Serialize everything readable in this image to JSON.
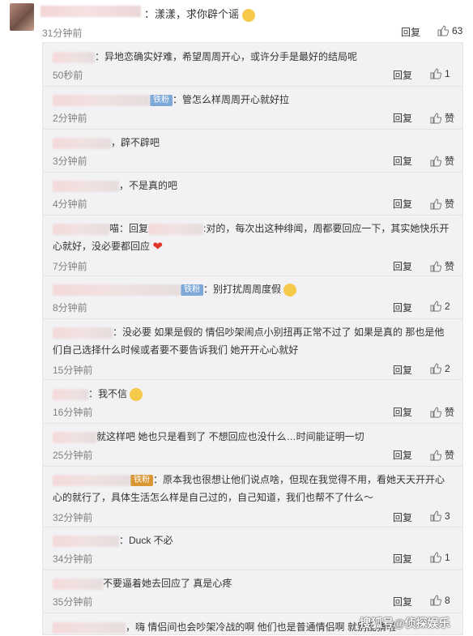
{
  "top_comment": {
    "text": "：漾漾，求你辟个谣",
    "time": "31分钟前",
    "reply": "回复",
    "likes": "63"
  },
  "replies": [
    {
      "text": "：异地恋确实好难，希望周周开心，或许分手是最好的结局呢",
      "time": "50秒前",
      "reply": "回复",
      "likes": "1"
    },
    {
      "badge": "铁粉",
      "text": "：管怎么样周周开心就好拉",
      "time": "2分钟前",
      "reply": "回复",
      "likes": "赞"
    },
    {
      "text": "，辟不辟吧",
      "time": "3分钟前",
      "reply": "回复",
      "likes": "赞"
    },
    {
      "text": "，不是真的吧",
      "time": "4分钟前",
      "reply": "回复",
      "likes": "赞"
    },
    {
      "text_a": "喵：回复",
      "text": ":对的，每次出这种绯闻，周都要回应一下，其实她快乐开",
      "text2": "心就好，没必要都回应",
      "time": "7分钟前",
      "reply": "回复",
      "likes": "赞"
    },
    {
      "badge": "铁粉",
      "text": "：别打扰周周度假",
      "time": "8分钟前",
      "reply": "回复",
      "likes": "2"
    },
    {
      "text": "：没必要 如果是假的 情侣吵架闹点小别扭再正常不过了 如果是真的 那也是他",
      "text2": "们自己选择什么时候或者要不要告诉我们 她开开心心就好",
      "time": "15分钟前",
      "reply": "回复",
      "likes": "2"
    },
    {
      "text": "：我不信",
      "time": "16分钟前",
      "reply": "回复",
      "likes": "赞"
    },
    {
      "text": "就这样吧 她也只是看到了 不想回应也没什么…时间能证明一切",
      "time": "25分钟前",
      "reply": "回复",
      "likes": "赞"
    },
    {
      "badge": "铁粉",
      "text": "：原本我也很想让他们说点啥，但现在我觉得不用，看她天天开开心",
      "text2": "心的就行了，具体生活怎么样是自己过的，自己知道，我们也帮不了什么～",
      "time": "32分钟前",
      "reply": "回复",
      "likes": "3"
    },
    {
      "text": "：Duck 不必",
      "time": "34分钟前",
      "reply": "回复",
      "likes": "1"
    },
    {
      "text": "不要逼着她去回应了 真是心疼",
      "time": "35分钟前",
      "reply": "回复",
      "likes": "8"
    },
    {
      "text": "，嗨 情侣间也会吵架冷战的啊 他们也是普通情侣啊 就别乱猜啦"
    }
  ],
  "watermark": "搜狐号@侦探娱乐",
  "colors": {
    "sub_bg": "#f2f2f5",
    "meta": "#808080",
    "badge_blue": "#7ea8d8",
    "badge_gold": "#d99632",
    "heart": "#e0352b"
  },
  "icons": [
    "thumbs-up-icon",
    "tearful-face-emoji",
    "red-heart-emoji",
    "grinning-sweat-emoji"
  ]
}
